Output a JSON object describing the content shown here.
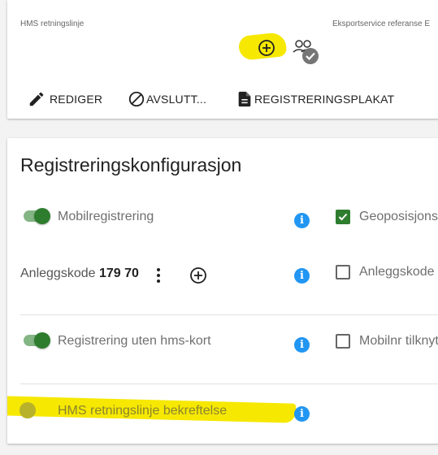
{
  "header": {
    "left_label": "HMS retningslinje",
    "right_label": "Eksportservice referanse E",
    "add_icon": "plus-circle-icon",
    "status_icon": "people-check-icon"
  },
  "actions": {
    "edit": {
      "label": "REDIGER",
      "icon": "pencil-icon"
    },
    "close": {
      "label": "AVSLUTT...",
      "icon": "block-icon"
    },
    "poster": {
      "label": "REGISTRERINGSPLAKAT",
      "icon": "document-icon"
    }
  },
  "config": {
    "title": "Registreringskonfigurasjon",
    "rows": [
      {
        "label": "Mobilregistrering",
        "enabled": true,
        "right_label": "Geoposisjons",
        "right_checked": true
      },
      {
        "label": "Anleggskode",
        "value": "179 70",
        "right_label": "Anleggskode",
        "right_checked": false
      },
      {
        "label": "Registrering uten hms-kort",
        "enabled": true,
        "right_label": "Mobilnr tilknyt",
        "right_checked": false
      },
      {
        "label": "HMS retningslinje bekreftelse",
        "enabled": false
      }
    ]
  },
  "colors": {
    "highlight": "#f6e800",
    "accent_green": "#2e7d2e",
    "info_blue": "#2196f3"
  }
}
